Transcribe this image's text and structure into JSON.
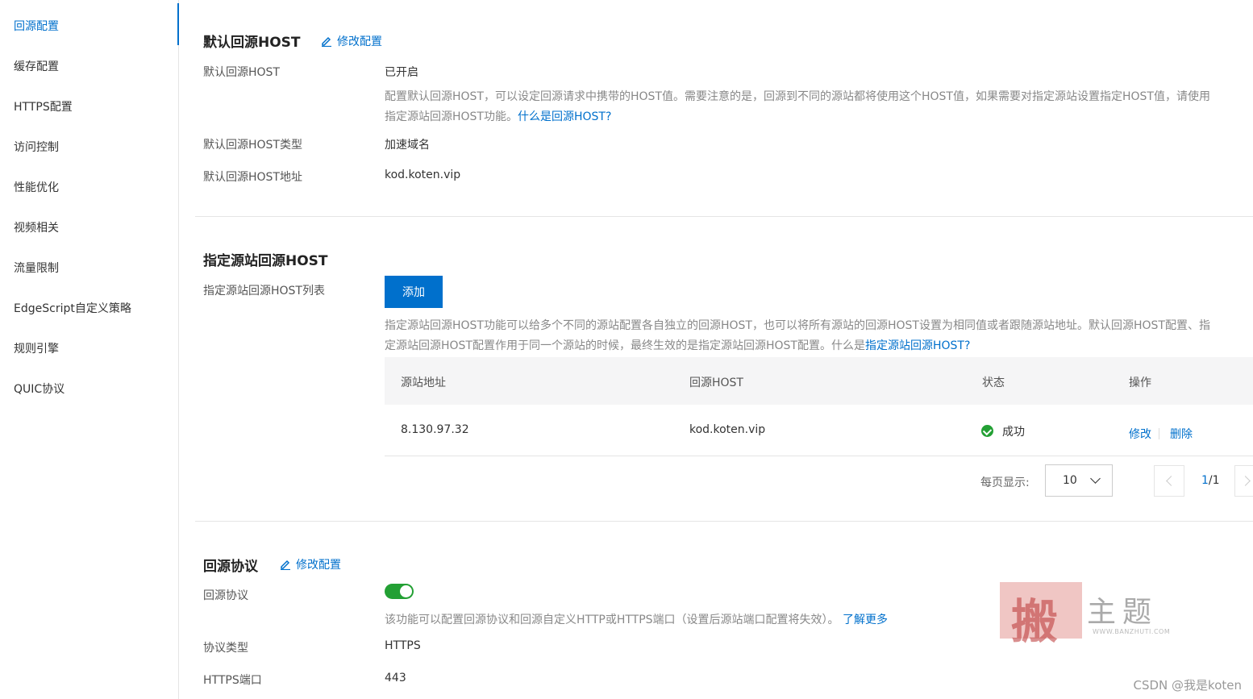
{
  "sidebar": {
    "items": [
      {
        "label": "回源配置",
        "active": true
      },
      {
        "label": "缓存配置"
      },
      {
        "label": "HTTPS配置"
      },
      {
        "label": "访问控制"
      },
      {
        "label": "性能优化"
      },
      {
        "label": "视频相关"
      },
      {
        "label": "流量限制"
      },
      {
        "label": "EdgeScript自定义策略"
      },
      {
        "label": "规则引擎"
      },
      {
        "label": "QUIC协议"
      }
    ]
  },
  "default_host": {
    "title": "默认回源HOST",
    "edit_label": "修改配置",
    "status_label": "默认回源HOST",
    "status_value": "已开启",
    "desc_line1": "配置默认回源HOST，可以设定回源请求中携带的HOST值。需要注意的是，回源到不同的源站都将使用这个HOST值，如果需要对指定源站设置指定HOST值，请使用",
    "desc_line2": "指定源站回源HOST功能。",
    "desc_link": "什么是回源HOST?",
    "type_label": "默认回源HOST类型",
    "type_value": "加速域名",
    "addr_label": "默认回源HOST地址",
    "addr_value": "kod.koten.vip"
  },
  "origin_host": {
    "title": "指定源站回源HOST",
    "list_label": "指定源站回源HOST列表",
    "add_label": "添加",
    "desc_line1": "指定源站回源HOST功能可以给多个不同的源站配置各自独立的回源HOST，也可以将所有源站的回源HOST设置为相同值或者跟随源站地址。默认回源HOST配置、指",
    "desc_line2": "定源站回源HOST配置作用于同一个源站的时候，最终生效的是指定源站回源HOST配置。什么是",
    "desc_link": "指定源站回源HOST?",
    "table": {
      "headers": [
        "源站地址",
        "回源HOST",
        "状态",
        "操作"
      ],
      "rows": [
        {
          "origin": "8.130.97.32",
          "host": "kod.koten.vip",
          "status": "成功",
          "edit": "修改",
          "delete": "删除"
        }
      ]
    },
    "pager": {
      "per_page_label": "每页显示:",
      "per_page_value": "10",
      "current": "1",
      "total": "/1"
    }
  },
  "protocol": {
    "title": "回源协议",
    "edit_label": "修改配置",
    "toggle_label": "回源协议",
    "toggle_on": true,
    "desc": "该功能可以配置回源协议和回源自定义HTTP或HTTPS端口（设置后源站端口配置将失效）。",
    "desc_link": "了解更多",
    "type_label": "协议类型",
    "type_value": "HTTPS",
    "port_label": "HTTPS端口",
    "port_value": "443"
  },
  "watermark": {
    "big": "搬",
    "text": "主题",
    "url": "WWW.BANZHUTI.COM"
  },
  "csdn": "CSDN @我是koten"
}
